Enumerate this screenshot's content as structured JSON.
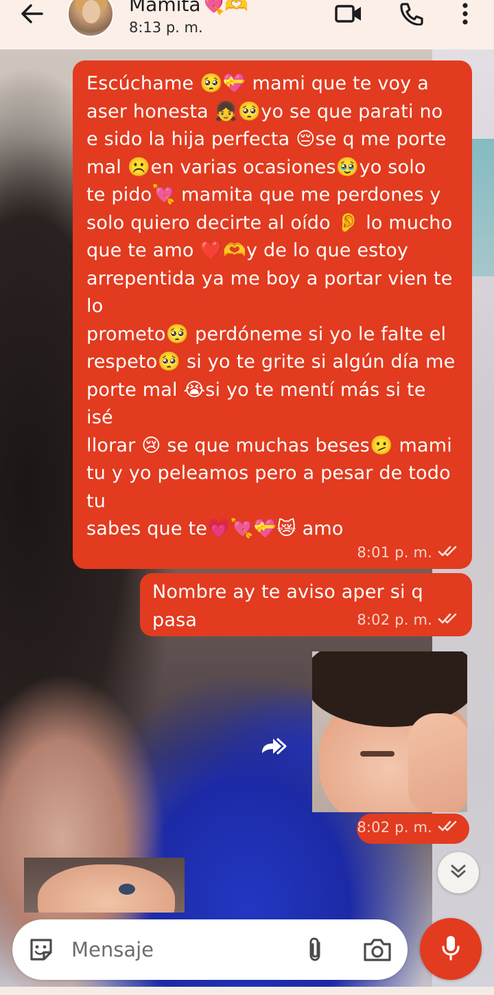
{
  "header": {
    "contact_name": "Mamita💘🫶",
    "last_seen": "8:13 p. m."
  },
  "messages": [
    {
      "text": "Escúchame 🥺💝 mami que te voy a\naser honesta 👧🥺yo se que parati no\ne sido la hija perfecta 😔se q me porte\nmal ☹️en varias ocasiones🥹yo solo\nte pido💘 mamita que me perdones y\nsolo quiero decirte al oído 👂 lo mucho\nque te amo ❤️🫶y de lo que estoy\narrepentida ya me boy a portar vien te lo\nprometo🥺 perdóneme si yo le falte el\nrespeto🥺 si yo te grite si algún día me\nporte mal 😭si yo te mentí más si te isé\nllorar 😢 se que muchas beses🫤 mami\ntu y yo peleamos pero a pesar de todo tu\nsabes que te💗💘💝😿 amo",
      "time": "8:01 p. m."
    },
    {
      "text": "Nombre ay te aviso aper si q pasa",
      "time": "8:02 p. m."
    },
    {
      "text": "",
      "time": "8:02 p. m."
    }
  ],
  "input": {
    "placeholder": "Mensaje"
  },
  "colors": {
    "bubble": "#e23b1f",
    "header_bg": "#fbefe8",
    "input_bg": "#ffffff"
  },
  "icons": [
    "back-arrow-icon",
    "video-call-icon",
    "phone-icon",
    "more-vert-icon",
    "double-check-icon",
    "forward-icon",
    "chevron-double-down-icon",
    "sticker-icon",
    "attach-icon",
    "camera-icon",
    "mic-icon"
  ]
}
